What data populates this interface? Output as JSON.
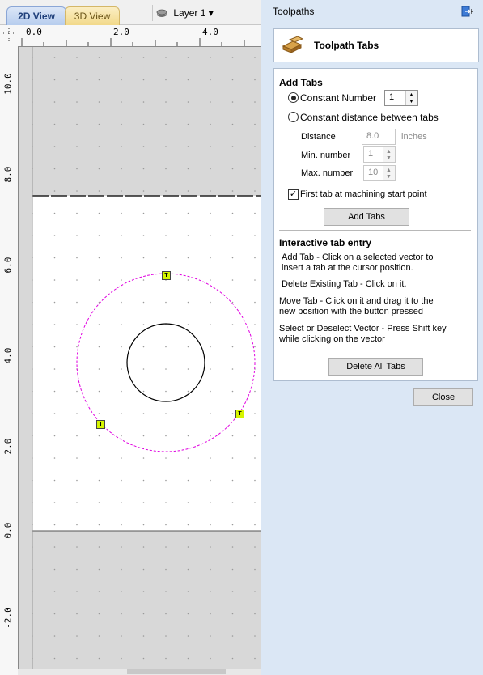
{
  "view_tabs": {
    "tab_2d": "2D View",
    "tab_3d": "3D View"
  },
  "layer": {
    "label": "Layer 1",
    "arrow": "▾"
  },
  "rulers": {
    "top": [
      "0.0",
      "2.0",
      "4.0"
    ],
    "left": [
      "10.0",
      "8.0",
      "6.0",
      "4.0",
      "2.0",
      "0.0",
      "-2.0"
    ]
  },
  "canvas": {
    "tab_marker_label": "T",
    "colors": {
      "background": "#d8d8d8",
      "material": "#ffffff",
      "tab_path": "#e000e0",
      "tab_marker": "#d6f500",
      "vector": "#000000"
    }
  },
  "panel": {
    "title": "Toolpaths",
    "header": "Toolpath Tabs",
    "add_tabs": {
      "heading": "Add Tabs",
      "constant_number_label": "Constant Number",
      "constant_number_value": "1",
      "constant_distance_label": "Constant distance between tabs",
      "distance_label": "Distance",
      "distance_value": "8.0",
      "distance_unit": "inches",
      "min_label": "Min. number",
      "min_value": "1",
      "max_label": "Max. number",
      "max_value": "10",
      "first_tab_label": "First tab at machining start point",
      "add_button": "Add Tabs"
    },
    "interactive": {
      "heading": "Interactive tab entry",
      "line1a": "Add Tab - Click on a selected vector to",
      "line1b": "insert a tab at the cursor position.",
      "line2": "Delete Existing Tab - Click on it.",
      "line3a": "Move Tab - Click on it and drag it to the",
      "line3b": "new position with the button pressed",
      "line4a": "Select or Deselect Vector - Press Shift key",
      "line4b": "while clicking on the vector",
      "delete_all_button": "Delete All Tabs"
    },
    "close_button": "Close"
  }
}
